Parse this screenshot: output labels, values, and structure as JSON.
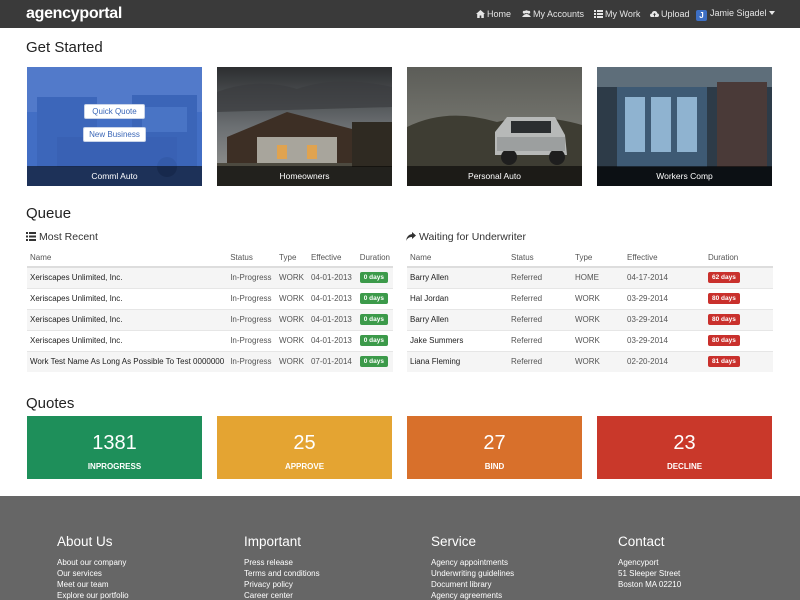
{
  "nav": {
    "brand": "agencyportal",
    "items": [
      {
        "icon": "home-icon",
        "label": "Home"
      },
      {
        "icon": "users-icon",
        "label": "My Accounts"
      },
      {
        "icon": "list-icon",
        "label": "My Work"
      },
      {
        "icon": "cloud-upload-icon",
        "label": "Upload"
      }
    ],
    "user": {
      "initial": "J",
      "name": "Jamie Sigadel"
    }
  },
  "get_started": {
    "title": "Get Started",
    "quick_quote": "Quick Quote",
    "new_business": "New Business",
    "cards": [
      "Comml Auto",
      "Homeowners",
      "Personal Auto",
      "Workers Comp"
    ]
  },
  "queue": {
    "title": "Queue",
    "most_recent": {
      "title": "Most Recent",
      "headers": [
        "Name",
        "Status",
        "Type",
        "Effective",
        "Duration"
      ],
      "rows": [
        [
          "Xeriscapes Unlimited, Inc.",
          "In-Progress",
          "WORK",
          "04-01-2013",
          "0 days"
        ],
        [
          "Xeriscapes Unlimited, Inc.",
          "In-Progress",
          "WORK",
          "04-01-2013",
          "0 days"
        ],
        [
          "Xeriscapes Unlimited, Inc.",
          "In-Progress",
          "WORK",
          "04-01-2013",
          "0 days"
        ],
        [
          "Xeriscapes Unlimited, Inc.",
          "In-Progress",
          "WORK",
          "04-01-2013",
          "0 days"
        ],
        [
          "Work Test Name As Long As Possible To Test 0000000",
          "In-Progress",
          "WORK",
          "07-01-2014",
          "0 days"
        ]
      ]
    },
    "waiting": {
      "title": "Waiting for Underwriter",
      "headers": [
        "Name",
        "Status",
        "Type",
        "Effective",
        "Duration"
      ],
      "rows": [
        [
          "Barry Allen",
          "Referred",
          "HOME",
          "04-17-2014",
          "62 days"
        ],
        [
          "Hal Jordan",
          "Referred",
          "WORK",
          "03-29-2014",
          "80 days"
        ],
        [
          "Barry Allen",
          "Referred",
          "WORK",
          "03-29-2014",
          "80 days"
        ],
        [
          "Jake Summers",
          "Referred",
          "WORK",
          "03-29-2014",
          "80 days"
        ],
        [
          "Liana Fleming",
          "Referred",
          "WORK",
          "02-20-2014",
          "81 days"
        ]
      ]
    }
  },
  "quotes": {
    "title": "Quotes",
    "boxes": [
      {
        "value": "1381",
        "label": "INPROGRESS",
        "color": "#1e8f5a"
      },
      {
        "value": "25",
        "label": "APPROVE",
        "color": "#e4a432"
      },
      {
        "value": "27",
        "label": "BIND",
        "color": "#d8702b"
      },
      {
        "value": "23",
        "label": "DECLINE",
        "color": "#c9382a"
      }
    ]
  },
  "footer": {
    "about": {
      "title": "About Us",
      "links": [
        "About our company",
        "Our services",
        "Meet our team",
        "Explore our portfolio"
      ]
    },
    "important": {
      "title": "Important",
      "links": [
        "Press release",
        "Terms and conditions",
        "Privacy policy",
        "Career center"
      ]
    },
    "service": {
      "title": "Service",
      "links": [
        "Agency appointments",
        "Underwriting guidelines",
        "Document library",
        "Agency agreements"
      ]
    },
    "contact": {
      "title": "Contact",
      "lines": [
        "Agencyport",
        "51 Sleeper Street",
        "Boston MA 02210"
      ]
    }
  }
}
